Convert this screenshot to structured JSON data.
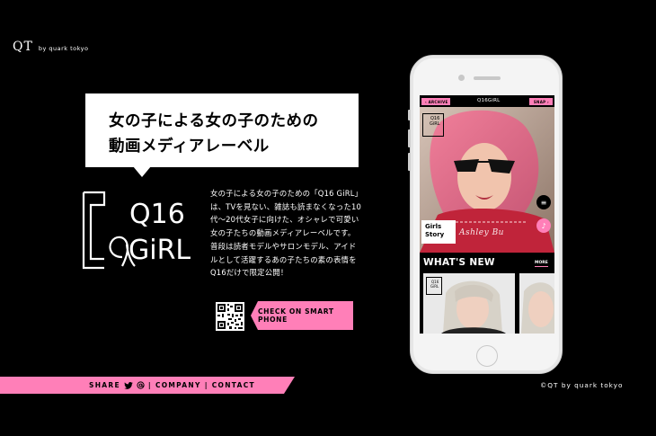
{
  "brand": {
    "mark": "QT",
    "sub": "by quark tokyo"
  },
  "hero": {
    "headline_line1": "女の子による女の子のための",
    "headline_line2": "動画メディアレーベル"
  },
  "q16_logo": {
    "line1": "Q16",
    "line2": "GiRL"
  },
  "description": [
    "女の子による女の子のための「Q16 GiRL」",
    "は、TVを見ない、雑誌も読まなくなった10",
    "代〜20代女子に向けた、オシャレで可愛い",
    "女の子たちの動画メディアレーベルです。",
    "普段は読者モデルやサロンモデル、アイド",
    "ルとして活躍するあの子たちの素の表情を",
    "Q16だけで限定公開！"
  ],
  "cta": {
    "label": "CHECK ON SMART PHONE"
  },
  "footer": {
    "share_label": "SHARE",
    "company_label": "COMPANY",
    "contact_label": "CONTACT",
    "sep1": "|",
    "sep2": "|",
    "copyright": "©QT by quark tokyo"
  },
  "phone_app": {
    "archive_label": "ARCHIVE",
    "snap_label": "SNAP",
    "logo": "Q16GiRL",
    "badge_line1": "Q16",
    "badge_line2": "GiRL",
    "story_line1": "Girls",
    "story_line2": "Story",
    "signature": "Ashley Bu",
    "whats_new": "WHAT'S NEW",
    "more_label": "MORE",
    "card_badge_line1": "Q16",
    "card_badge_line2": "GiRL"
  },
  "colors": {
    "accent": "#ff7fb8",
    "background": "#000000",
    "text": "#ffffff"
  },
  "icons": [
    "twitter-icon",
    "at-icon",
    "menu-icon",
    "music-icon",
    "chevron-left-icon",
    "chevron-right-icon",
    "qr-code-icon"
  ]
}
